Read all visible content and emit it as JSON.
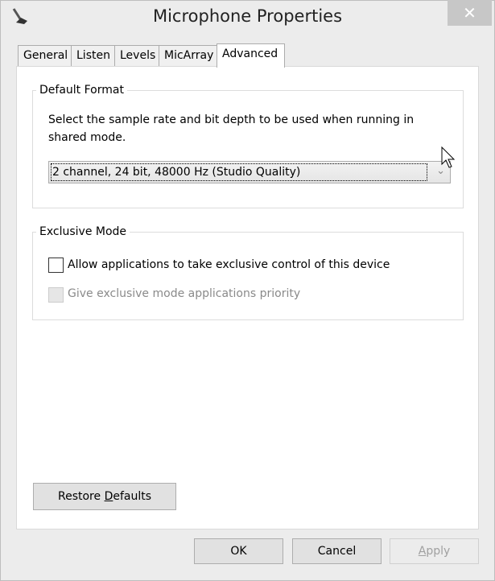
{
  "window": {
    "title": "Microphone Properties",
    "close_icon": "close-icon",
    "app_icon": "microphone-icon"
  },
  "tabs": [
    {
      "label": "General"
    },
    {
      "label": "Listen"
    },
    {
      "label": "Levels"
    },
    {
      "label": "MicArray"
    },
    {
      "label": "Advanced",
      "active": true
    }
  ],
  "default_format": {
    "legend": "Default Format",
    "description": "Select the sample rate and bit depth to be used when running in shared mode.",
    "selected": "2 channel, 24 bit, 48000 Hz (Studio Quality)"
  },
  "exclusive_mode": {
    "legend": "Exclusive Mode",
    "allow_label": "Allow applications to take exclusive control of this device",
    "allow_checked": false,
    "priority_label": "Give exclusive mode applications priority",
    "priority_checked": false,
    "priority_disabled": true
  },
  "buttons": {
    "restore_pre": "Restore ",
    "restore_u": "D",
    "restore_post": "efaults",
    "ok": "OK",
    "cancel": "Cancel",
    "apply_u": "A",
    "apply_post": "pply"
  }
}
